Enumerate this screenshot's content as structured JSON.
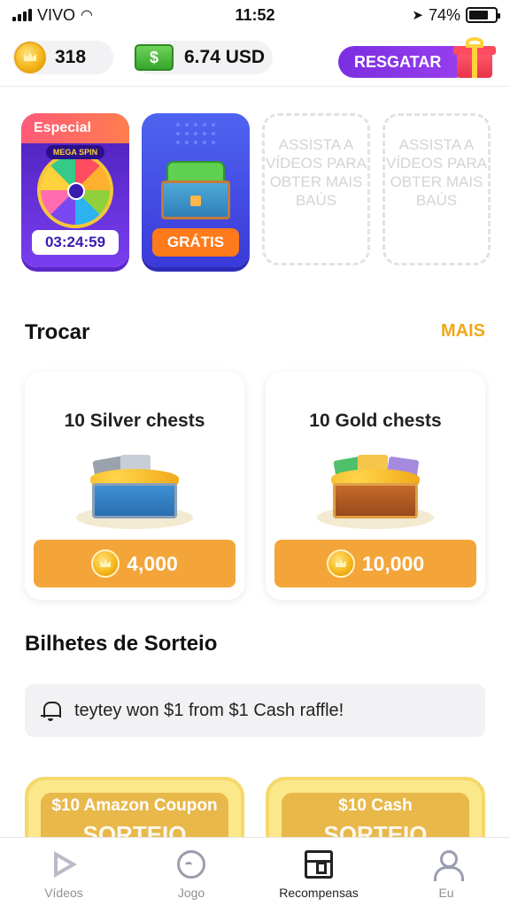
{
  "status_bar": {
    "carrier": "VIVO",
    "time": "11:52",
    "battery": "74%",
    "battery_level": 0.74
  },
  "header": {
    "coins": "318",
    "cash": "6.74 USD",
    "redeem_label": "RESGATAR"
  },
  "chests": {
    "special_label": "Especial",
    "wheel_text": "MEGA SPIN",
    "timer": "03:24:59",
    "free_label": "GRÁTIS",
    "empty_slot_text": "ASSISTA A VÍDEOS PARA OBTER MAIS BAÚS"
  },
  "exchange": {
    "title": "Trocar",
    "more_label": "MAIS",
    "items": [
      {
        "title": "10 Silver chests",
        "price": "4,000"
      },
      {
        "title": "10 Gold chests",
        "price": "10,000"
      }
    ]
  },
  "raffle": {
    "title": "Bilhetes de Sorteio",
    "notice": "teytey won $1 from $1 Cash raffle!",
    "cards": [
      {
        "label": "$10 Amazon Coupon",
        "sub": "SORTEIO"
      },
      {
        "label": "$10 Cash",
        "sub": "SORTEIO"
      }
    ]
  },
  "tabs": [
    {
      "label": "Vídeos",
      "icon": "play-icon",
      "active": false
    },
    {
      "label": "Jogo",
      "icon": "game-icon",
      "active": false
    },
    {
      "label": "Recompensas",
      "icon": "chest-icon",
      "active": true
    },
    {
      "label": "Eu",
      "icon": "user-icon",
      "active": false
    }
  ]
}
